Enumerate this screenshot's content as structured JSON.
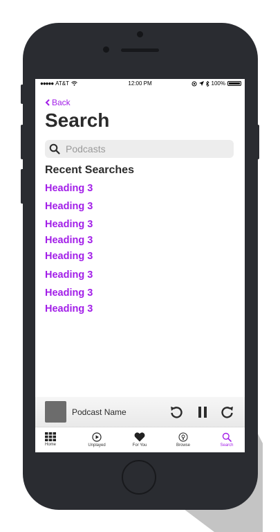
{
  "status_bar": {
    "carrier": "AT&T",
    "time": "12:00 PM",
    "battery": "100%"
  },
  "nav": {
    "back_label": "Back",
    "title": "Search"
  },
  "search": {
    "placeholder": "Podcasts"
  },
  "recent": {
    "title": "Recent Searches",
    "items": [
      "Heading 3",
      "Heading 3",
      "Heading 3",
      "Heading 3",
      "Heading 3",
      "Heading 3",
      "Heading 3",
      "Heading 3"
    ]
  },
  "player": {
    "podcast_name": "Podcast Name"
  },
  "tabs": [
    {
      "label": "Home",
      "icon": "grid-icon"
    },
    {
      "label": "Unplayed",
      "icon": "play-circle-icon"
    },
    {
      "label": "For You",
      "icon": "heart-icon"
    },
    {
      "label": "Browse",
      "icon": "podcast-icon"
    },
    {
      "label": "Search",
      "icon": "search-icon"
    }
  ],
  "colors": {
    "accent": "#a21ee8",
    "device": "#2a2c31",
    "text": "#2b2b2b"
  }
}
